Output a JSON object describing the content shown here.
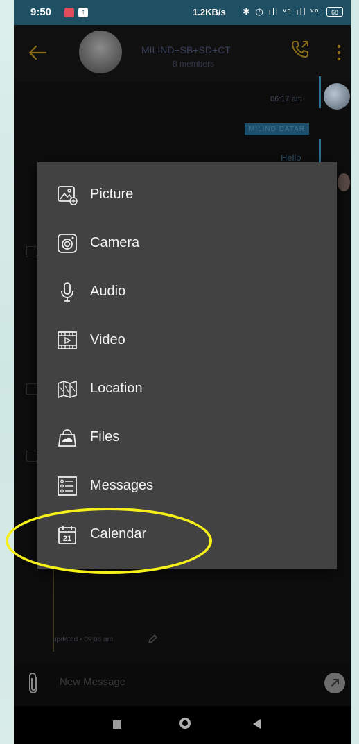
{
  "status_bar": {
    "time": "9:50",
    "speed": "1.2KB/s",
    "indicators": "✱ ◷ ıll ᵛᵒ ıll ᵛᵒ",
    "battery": "68"
  },
  "header": {
    "title": "MILIND+SB+SD+CT",
    "subtitle": "8 members"
  },
  "chat": {
    "time_1": "06:17 am",
    "sender": "MILIND DATAR",
    "message": "Hello",
    "updated": "updated • 09:06 am"
  },
  "composer": {
    "placeholder": "New Message"
  },
  "menu": {
    "items": [
      {
        "label": "Picture",
        "icon": "picture-icon"
      },
      {
        "label": "Camera",
        "icon": "camera-icon"
      },
      {
        "label": "Audio",
        "icon": "microphone-icon"
      },
      {
        "label": "Video",
        "icon": "video-icon"
      },
      {
        "label": "Location",
        "icon": "map-icon"
      },
      {
        "label": "Files",
        "icon": "files-icon"
      },
      {
        "label": "Messages",
        "icon": "messages-icon"
      },
      {
        "label": "Calendar",
        "icon": "calendar-icon"
      }
    ],
    "calendar_day": "21"
  },
  "colors": {
    "status_bar": "#1f4f63",
    "menu_bg": "#424242",
    "highlight": "#f5ef1a",
    "accent": "#b8860b"
  }
}
